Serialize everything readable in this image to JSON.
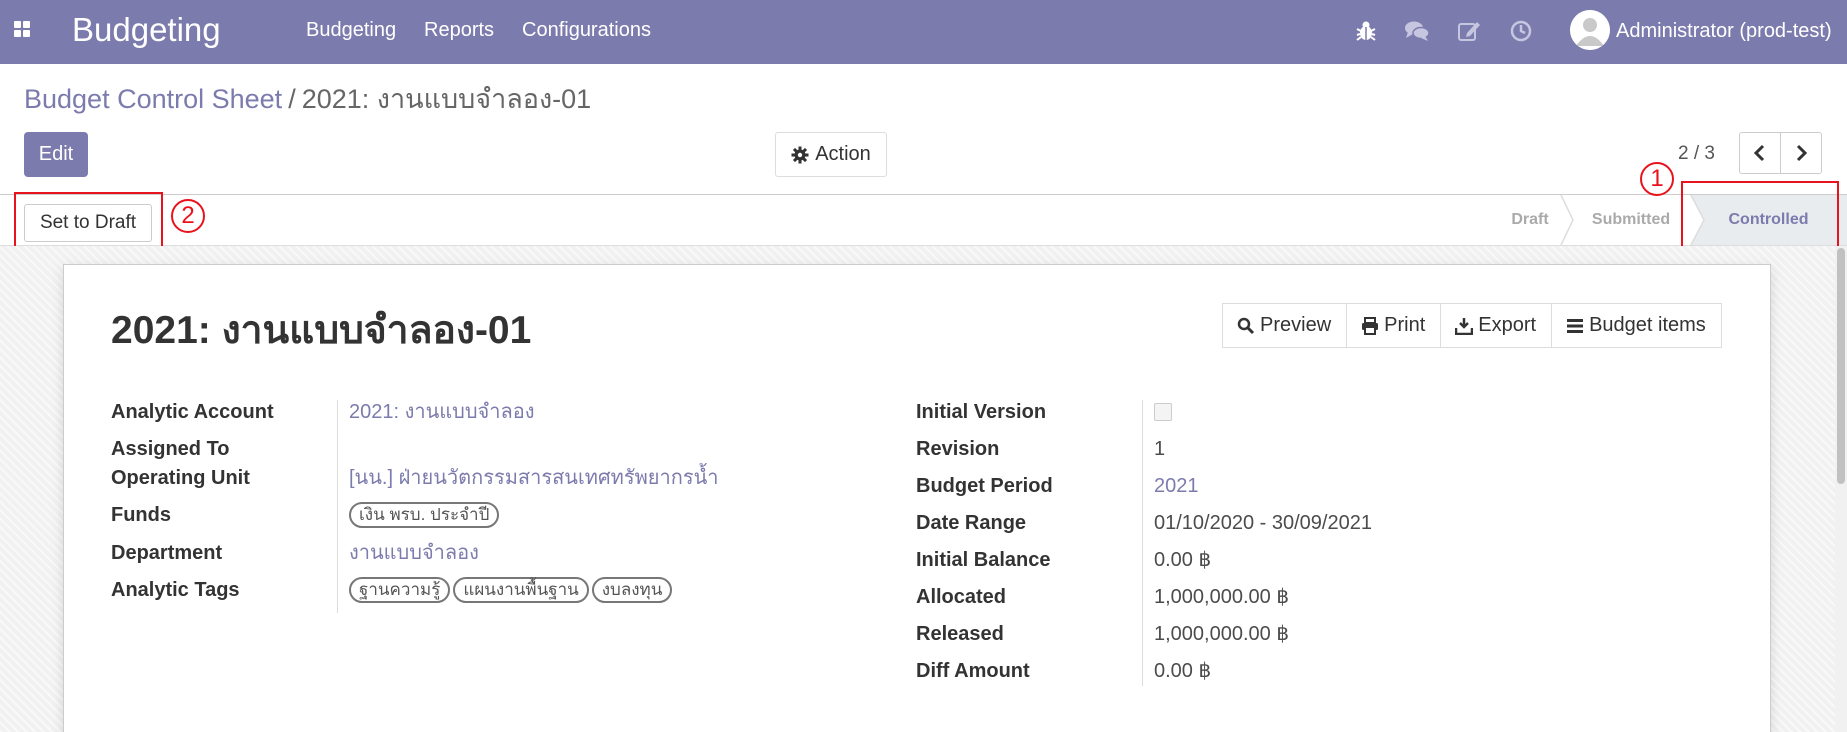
{
  "navbar": {
    "brand": "Budgeting",
    "menu": [
      "Budgeting",
      "Reports",
      "Configurations"
    ],
    "icons": [
      "bug-icon",
      "chat-icon",
      "edit-icon",
      "clock-icon"
    ],
    "user_name": "Administrator (prod-test)",
    "color": "#7c7bad"
  },
  "breadcrumb": {
    "parent": "Budget Control Sheet",
    "separator": "/",
    "current": "2021: งานแบบจำลอง-01"
  },
  "control": {
    "edit_label": "Edit",
    "action_label": "Action",
    "pager": "2 / 3"
  },
  "statusbar": {
    "set_to_draft_label": "Set to Draft",
    "steps": [
      "Draft",
      "Submitted",
      "Controlled"
    ],
    "active_step": "Controlled"
  },
  "annotations": {
    "one": "1",
    "two": "2",
    "color": "#e8131c"
  },
  "record": {
    "title": "2021: งานแบบจำลอง-01",
    "smart_buttons": {
      "preview": "Preview",
      "print": "Print",
      "export": "Export",
      "budget_items": "Budget items"
    },
    "left_fields": {
      "analytic_account": {
        "label": "Analytic Account",
        "value": "2021: งานแบบจำลอง"
      },
      "assigned_to": {
        "label": "Assigned To",
        "value": ""
      },
      "operating_unit": {
        "label": "Operating Unit",
        "value": "[นน.] ฝ่ายนวัตกรรมสารสนเทศทรัพยากรน้ำ"
      },
      "funds": {
        "label": "Funds",
        "tags": [
          "เงิน พรบ. ประจำปี"
        ]
      },
      "department": {
        "label": "Department",
        "value": "งานแบบจำลอง"
      },
      "analytic_tags": {
        "label": "Analytic Tags",
        "tags": [
          "ฐานความรู้",
          "แผนงานพื้นฐาน",
          "งบลงทุน"
        ]
      }
    },
    "right_fields": {
      "initial_version": {
        "label": "Initial Version",
        "checked": false
      },
      "revision": {
        "label": "Revision",
        "value": "1"
      },
      "budget_period": {
        "label": "Budget Period",
        "value": "2021"
      },
      "date_range": {
        "label": "Date Range",
        "value": "01/10/2020 - 30/09/2021"
      },
      "initial_balance": {
        "label": "Initial Balance",
        "value": "0.00 ฿"
      },
      "allocated": {
        "label": "Allocated",
        "value": "1,000,000.00 ฿"
      },
      "released": {
        "label": "Released",
        "value": "1,000,000.00 ฿"
      },
      "diff_amount": {
        "label": "Diff Amount",
        "value": "0.00 ฿"
      }
    }
  }
}
